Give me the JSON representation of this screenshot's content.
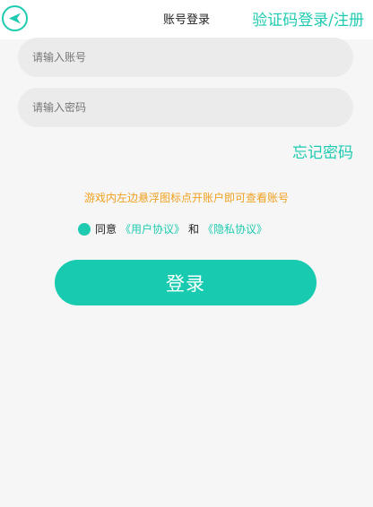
{
  "header": {
    "title": "账号登录",
    "switch_label": "验证码登录/注册"
  },
  "form": {
    "account_placeholder": "请输入账号",
    "password_placeholder": "请输入密码",
    "forgot_label": "忘记密码"
  },
  "hint": "游戏内左边悬浮图标点开账户即可查看账号",
  "agreement": {
    "prefix": "同意",
    "user_agreement": "《用户协议》",
    "joiner": "和",
    "privacy_policy": "《隐私协议》"
  },
  "login_label": "登录",
  "colors": {
    "accent": "#1fcbb0",
    "hint": "#f0a020",
    "background": "#f6f6f6"
  },
  "icons": {
    "back": "back-arrow-icon",
    "agree": "agree-radio-icon"
  }
}
